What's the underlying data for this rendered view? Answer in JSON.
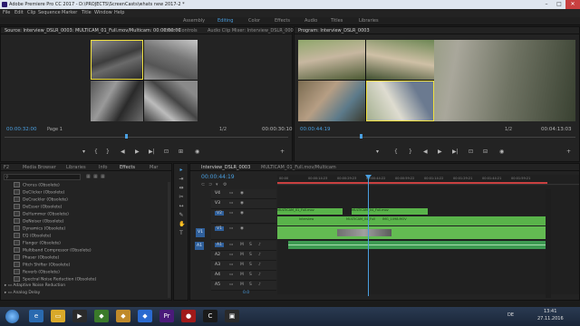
{
  "window": {
    "title": "Adobe Premiere Pro CC 2017 - D:\\PROJECTS\\ScreenCasts\\whats new 2017-2 *",
    "min": "–",
    "max": "□",
    "close": "✕"
  },
  "menu": [
    "File",
    "Edit",
    "Clip",
    "Sequence",
    "Marker",
    "Title",
    "Window",
    "Help"
  ],
  "workspaces": [
    "Assembly",
    "Editing",
    "Color",
    "Effects",
    "Audio",
    "Titles",
    "Libraries"
  ],
  "workspace_active": "Editing",
  "source": {
    "tabs": [
      "Source: Interview_DSLR_0003: MULTICAM_01_Full.mov/Multicam: 00:00:00:00",
      "Effect Controls",
      "Audio Clip Mixer: Interview_DSLR_000"
    ],
    "timecode_left": "00:00:32:00",
    "page": "Page 1",
    "fraction": "1/2",
    "timecode_right": "00:00:30:10"
  },
  "program": {
    "tab": "Program: Interview_DSLR_0003",
    "timecode_left": "00:00:44:19",
    "fraction": "1/2",
    "timecode_right": "00:04:13:03"
  },
  "effects_panel": {
    "tabs": [
      "F2",
      "Media Browser",
      "Libraries",
      "Info",
      "Effects",
      "Mar"
    ],
    "items": [
      "Chorus (Obsolete)",
      "DeClicker (Obsolete)",
      "DeCrackler (Obsolete)",
      "DeEsser (Obsolete)",
      "DeHummer (Obsolete)",
      "DeNoiser (Obsolete)",
      "Dynamics (Obsolete)",
      "EQ (Obsolete)",
      "Flanger (Obsolete)",
      "Multiband Compressor (Obsolete)",
      "Phaser (Obsolete)",
      "Pitch Shifter (Obsolete)",
      "Reverb (Obsolete)",
      "Spectral Noise Reduction (Obsolete)"
    ],
    "folders": [
      "Adaptive Noise Reduction",
      "Analog Delay"
    ]
  },
  "timeline": {
    "tabs": [
      "Interview_DSLR_0003",
      "MULTICAM_01_Full.mov/Multicam"
    ],
    "timecode": "00:00:44:19",
    "ruler": [
      "00:00",
      "00:00:14:23",
      "00:00:29:23",
      "00:00:44:22",
      "00:00:59:22",
      "00:01:14:22",
      "00:01:29:21",
      "00:01:44:21",
      "00:01:59:21"
    ],
    "video_tracks": [
      "V4",
      "V3",
      "V2",
      "V1"
    ],
    "audio_tracks": [
      "A1",
      "A2",
      "A3",
      "A4",
      "A5"
    ],
    "source_patch_v": "V1",
    "source_patch_a": "A1",
    "clips": {
      "v3a": "MULTICAM_01_Full.mov",
      "v3b": "MULTICAM_04_Full.mov",
      "v2a": "Interview",
      "v2b": "MULTICAM_04_Full",
      "v2c": "IMG_1098.MOV"
    },
    "footer_mark": "0.0"
  },
  "taskbar": {
    "time": "13:41",
    "date": "27.11.2016",
    "lang": "DE"
  },
  "colors": {
    "accent": "#4a9fe0",
    "playhead": "#4a9fe0",
    "selection": "#f0e040",
    "clip_green": "#59b34a",
    "clip_audio": "#3e9a52"
  }
}
